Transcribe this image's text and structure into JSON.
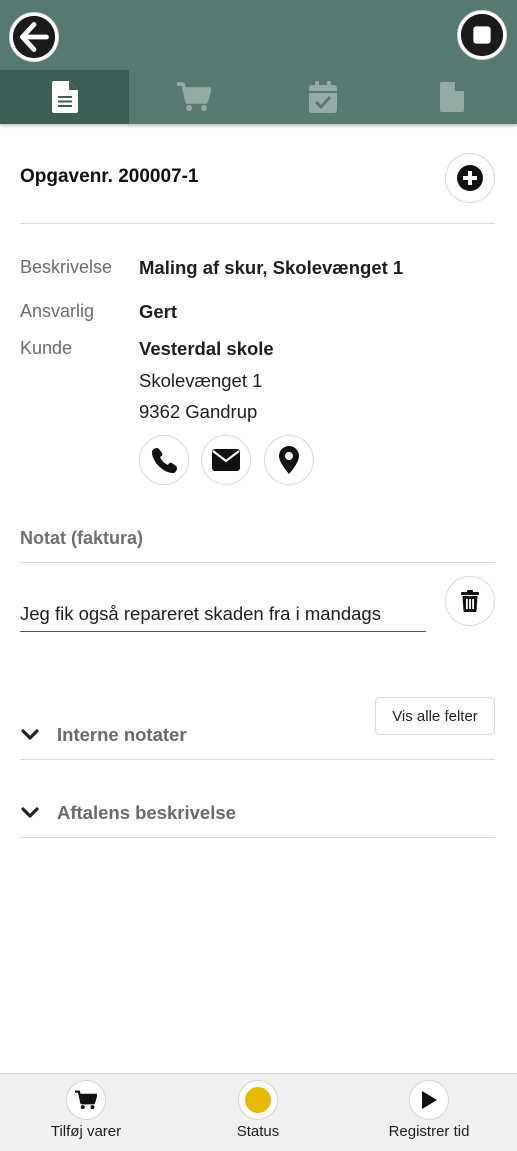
{
  "header": {
    "tabs": [
      {
        "icon": "document-icon",
        "active": true
      },
      {
        "icon": "cart-icon",
        "active": false
      },
      {
        "icon": "calendar-check-icon",
        "active": false
      },
      {
        "icon": "file-icon",
        "active": false
      }
    ],
    "colors": {
      "bar": "#567a72",
      "active_tab": "#3d5e57"
    }
  },
  "task": {
    "title": "Opgavenr. 200007-1"
  },
  "details": {
    "description_label": "Beskrivelse",
    "description_value": "Maling af skur, Skolevænget 1",
    "responsible_label": "Ansvarlig",
    "responsible_value": "Gert",
    "customer_label": "Kunde",
    "customer_name": "Vesterdal skole",
    "customer_street": "Skolevænget 1",
    "customer_city": "9362 Gandrup"
  },
  "note": {
    "heading": "Notat (faktura)",
    "value": "Jeg fik også repareret skaden fra i mandags"
  },
  "buttons": {
    "show_all_fields": "Vis alle felter"
  },
  "sections": {
    "internal_notes": "Interne notater",
    "agreement_description": "Aftalens beskrivelse"
  },
  "bottom_bar": {
    "add_items": "Tilføj varer",
    "status": "Status",
    "register_time": "Registrer tid",
    "status_color": "#e6b800"
  }
}
